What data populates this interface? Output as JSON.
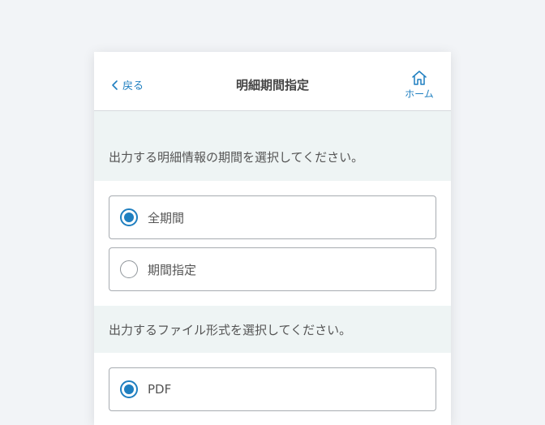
{
  "header": {
    "back_label": "戻る",
    "title": "明細期間指定",
    "home_label": "ホーム"
  },
  "period_section": {
    "prompt": "出力する明細情報の期間を選択してください。",
    "options": [
      {
        "label": "全期間",
        "selected": true
      },
      {
        "label": "期間指定",
        "selected": false
      }
    ]
  },
  "format_section": {
    "prompt": "出力するファイル形式を選択してください。",
    "options": [
      {
        "label": "PDF",
        "selected": true
      }
    ]
  },
  "colors": {
    "accent": "#1f7fc0",
    "prompt_background": "#eef4f4",
    "page_background": "#f2f4f7"
  }
}
